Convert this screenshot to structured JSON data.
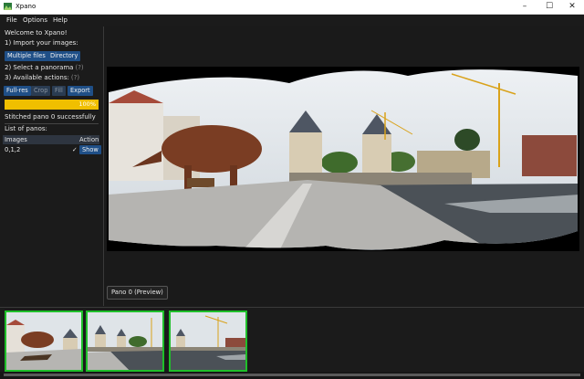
{
  "window": {
    "title": "Xpano",
    "minimize": "–",
    "maximize": "☐",
    "close": "✕"
  },
  "menu": {
    "file": "File",
    "options": "Options",
    "help": "Help"
  },
  "sidebar": {
    "welcome": "Welcome to Xpano!",
    "step1": "1) Import your images:",
    "multiple_files": "Multiple files",
    "directory": "Directory",
    "step2": "2) Select a panorama",
    "step3": "3) Available actions:",
    "help_mark": "(?)",
    "actions": {
      "full_res": "Full-res",
      "crop": "Crop",
      "fill": "Fill",
      "export": "Export"
    },
    "progress": {
      "value": 100,
      "label": "100%"
    },
    "status": "Stitched pano 0 successfully",
    "list_title": "List of panos:",
    "table": {
      "columns": [
        "Images",
        "Action"
      ],
      "rows": [
        {
          "images": "0,1,2",
          "check": "✓",
          "action": "Show"
        }
      ]
    }
  },
  "viewer": {
    "preview_label": "Pano 0 (Preview)"
  },
  "thumbnails": [
    "image-0",
    "image-1",
    "image-2"
  ],
  "colors": {
    "accent_button": "#1f4f87",
    "progress": "#f0bf00",
    "thumb_border": "#1fbf2a"
  }
}
